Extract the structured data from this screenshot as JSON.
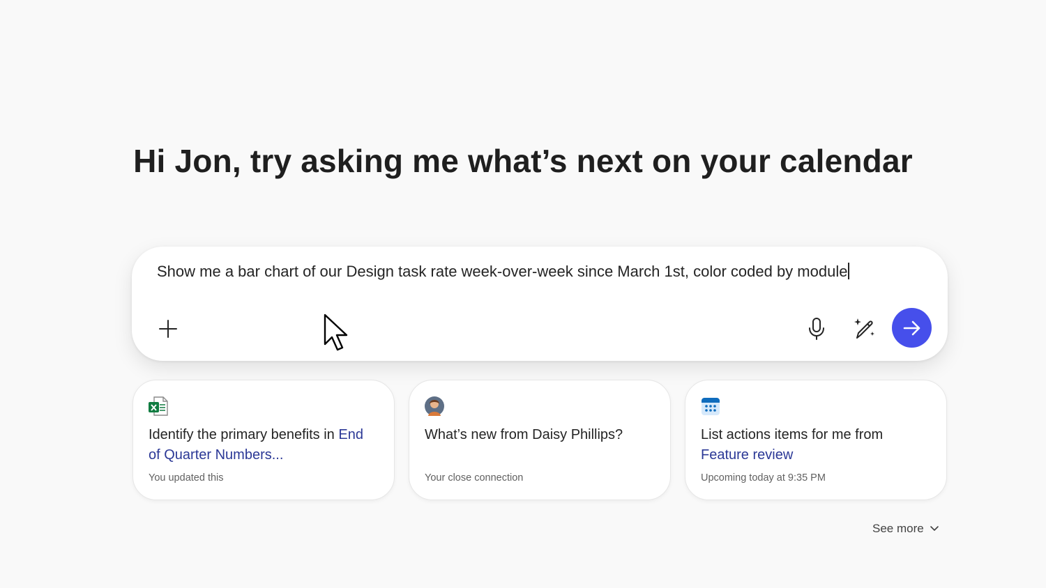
{
  "greeting": "Hi Jon, try asking me what’s next on your calendar",
  "composer": {
    "input_value": "Show me a bar chart of our Design task rate week-over-week since March 1st, color coded by module",
    "icons": {
      "attach": "plus-icon",
      "mic": "microphone-icon",
      "prompts": "sparkle-pen-icon",
      "send": "arrow-right-icon"
    },
    "send_color": "#464feb"
  },
  "suggestions": [
    {
      "icon": "excel-file-icon",
      "title_prefix": "Identify the primary benefits in ",
      "title_link": "End of Quarter Numbers...",
      "subtitle": "You updated this"
    },
    {
      "icon": "person-avatar-icon",
      "title_prefix": "What’s new from Daisy Phillips?",
      "title_link": "",
      "subtitle": "Your close connection"
    },
    {
      "icon": "calendar-icon",
      "title_prefix": "List actions items for me from ",
      "title_link": "Feature review",
      "subtitle": "Upcoming today at 9:35 PM"
    }
  ],
  "see_more": "See more",
  "colors": {
    "background": "#f9f9f9",
    "link": "#2b3896",
    "excel_green": "#107c41",
    "calendar_blue": "#0f6cbd"
  }
}
